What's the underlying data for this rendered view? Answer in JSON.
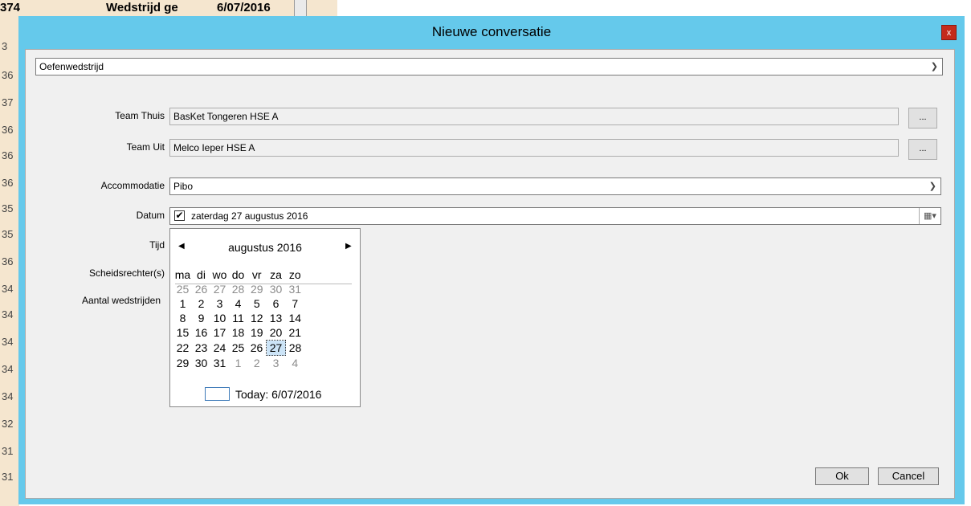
{
  "background": {
    "top_cells": [
      "374",
      "Wedstrijd ge",
      "6/07/2016"
    ],
    "row_numbers": [
      "3",
      "36",
      "37",
      "36",
      "36",
      "36",
      "35",
      "35",
      "36",
      "34",
      "34",
      "34",
      "34",
      "34",
      "32",
      "31",
      "31"
    ]
  },
  "dialog": {
    "title": "Nieuwe conversatie",
    "close_label": "x",
    "type_select": "Oefenwedstrijd",
    "labels": {
      "team_thuis": "Team Thuis",
      "team_uit": "Team Uit",
      "accommodatie": "Accommodatie",
      "datum": "Datum",
      "tijd": "Tijd",
      "scheidsrechters": "Scheidsrechter(s)",
      "aantal": "Aantal wedstrijden"
    },
    "team_thuis_value": "BasKet Tongeren HSE A",
    "team_uit_value": "Melco Ieper HSE A",
    "browse_label": "...",
    "accommodatie_value": "Pibo",
    "date_value": "zaterdag  27  augustus  2016",
    "date_checked": true,
    "ok_label": "Ok",
    "cancel_label": "Cancel"
  },
  "calendar": {
    "month_label": "augustus 2016",
    "prev_arrow": "◀",
    "next_arrow": "▶",
    "weekdays": [
      "ma",
      "di",
      "wo",
      "do",
      "vr",
      "za",
      "zo"
    ],
    "weeks": [
      [
        "25",
        "26",
        "27",
        "28",
        "29",
        "30",
        "31"
      ],
      [
        "1",
        "2",
        "3",
        "4",
        "5",
        "6",
        "7"
      ],
      [
        "8",
        "9",
        "10",
        "11",
        "12",
        "13",
        "14"
      ],
      [
        "15",
        "16",
        "17",
        "18",
        "19",
        "20",
        "21"
      ],
      [
        "22",
        "23",
        "24",
        "25",
        "26",
        "27",
        "28"
      ],
      [
        "29",
        "30",
        "31",
        "1",
        "2",
        "3",
        "4"
      ]
    ],
    "selected_day": "27",
    "today_label": "Today: 6/07/2016"
  },
  "colors": {
    "dialog_frame": "#65c9eb",
    "close_button": "#c42b1c",
    "selected_day_bg": "#cce4f7"
  }
}
